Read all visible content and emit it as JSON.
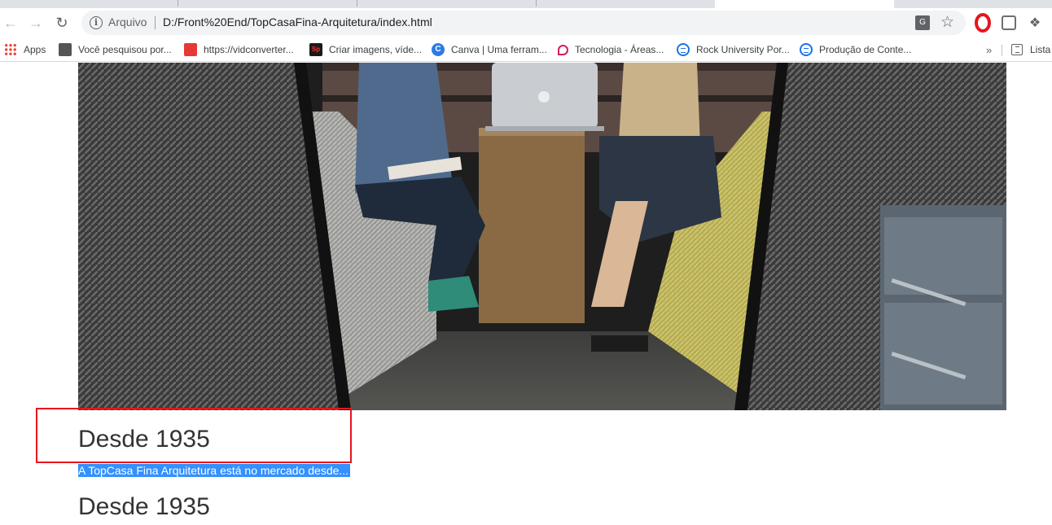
{
  "browser": {
    "scheme_label": "Arquivo",
    "url": "D:/Front%20End/TopCasaFina-Arquitetura/index.html",
    "icons": [
      "back-icon",
      "forward-icon",
      "reload-icon",
      "info-icon",
      "translate-icon",
      "star-icon",
      "opera-icon",
      "extension-icon",
      "puzzle-icon"
    ]
  },
  "bookmarks": {
    "items": [
      {
        "label": "Apps",
        "icon": "apps-icon"
      },
      {
        "label": "Você pesquisou por...",
        "icon": "photo-icon"
      },
      {
        "label": "https://vidconverter...",
        "icon": "vidconverter-icon"
      },
      {
        "label": "Criar imagens, víde...",
        "icon": "spark-icon"
      },
      {
        "label": "Canva | Uma ferram...",
        "icon": "canva-icon"
      },
      {
        "label": "Tecnologia - Áreas...",
        "icon": "tecnologia-icon"
      },
      {
        "label": "Rock University Por...",
        "icon": "doc-icon"
      },
      {
        "label": "Produção de Conte...",
        "icon": "doc-icon"
      }
    ],
    "overflow": "»",
    "reading_list": "Lista"
  },
  "page": {
    "heading_1": "Desde 1935",
    "description": "A TopCasa Fina Arquitetura está no mercado desde...",
    "heading_2": "Desde 1935"
  },
  "colors": {
    "highlight": "#3390ff",
    "annotation_box": "#e8141c",
    "heading_text": "#333333"
  }
}
